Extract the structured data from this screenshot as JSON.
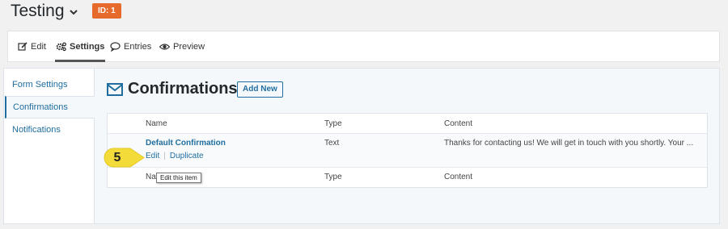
{
  "header": {
    "title": "Testing",
    "id_badge": "ID: 1",
    "badge_color": "#e66a2b"
  },
  "tabs": [
    {
      "label": "Edit",
      "icon": "pencil-square-icon",
      "active": false
    },
    {
      "label": "Settings",
      "icon": "gears-icon",
      "active": true
    },
    {
      "label": "Entries",
      "icon": "speech-bubble-icon",
      "active": false
    },
    {
      "label": "Preview",
      "icon": "eye-icon",
      "active": false
    }
  ],
  "sidebar": {
    "items": [
      {
        "label": "Form Settings",
        "active": false
      },
      {
        "label": "Confirmations",
        "active": true
      },
      {
        "label": "Notifications",
        "active": false
      }
    ]
  },
  "main": {
    "title": "Confirmations",
    "title_icon": "envelope-icon",
    "add_new_label": "Add New",
    "table": {
      "columns": [
        "Name",
        "Type",
        "Content"
      ],
      "rows": [
        {
          "name": "Default Confirmation",
          "type": "Text",
          "content": "Thanks for contacting us! We will get in touch with you shortly.  Your ...",
          "actions": [
            "Edit",
            "Duplicate"
          ]
        }
      ],
      "footer": [
        "Name",
        "Type",
        "Content"
      ]
    }
  },
  "annotation": {
    "step_number": "5",
    "tooltip": "Edit this item",
    "highlight_color": "#f3dc3a"
  },
  "colors": {
    "link": "#1f6e9f",
    "accent": "#e66a2b"
  }
}
